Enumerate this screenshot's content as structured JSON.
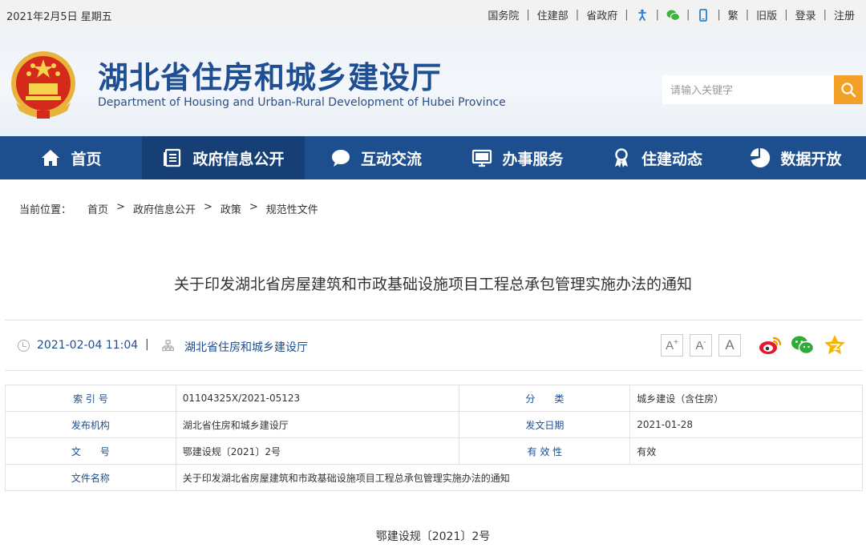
{
  "topbar": {
    "date": "2021年2月5日 星期五",
    "links": [
      "国务院",
      "住建部",
      "省政府",
      "繁",
      "旧版",
      "登录",
      "注册"
    ],
    "icons": [
      "accessibility-icon",
      "wechat-icon",
      "mobile-icon"
    ]
  },
  "header": {
    "title_cn": "湖北省住房和城乡建设厅",
    "title_en": "Department of Housing and Urban-Rural Development of Hubei Province",
    "search_placeholder": "请输入关键字"
  },
  "nav": {
    "items": [
      {
        "label": "首页",
        "icon": "home-icon"
      },
      {
        "label": "政府信息公开",
        "icon": "document-icon"
      },
      {
        "label": "互动交流",
        "icon": "chat-icon"
      },
      {
        "label": "办事服务",
        "icon": "monitor-icon"
      },
      {
        "label": "住建动态",
        "icon": "award-icon"
      },
      {
        "label": "数据开放",
        "icon": "pie-chart-icon"
      }
    ],
    "active_index": 1
  },
  "breadcrumb": {
    "prefix": "当前位置：",
    "items": [
      "首页",
      "政府信息公开",
      "政策",
      "规范性文件"
    ],
    "separator": ">"
  },
  "article": {
    "title": "关于印发湖北省房屋建筑和市政基础设施项目工程总承包管理实施办法的通知",
    "datetime": "2021-02-04 11:04",
    "divider": "|",
    "source": "湖北省住房和城乡建设厅",
    "font_buttons": [
      "A+",
      "A-",
      "A"
    ],
    "share_icons": [
      "weibo-icon",
      "wechat-icon",
      "favorite-star-icon"
    ],
    "doc_number_line": "鄂建设规〔2021〕2号"
  },
  "info_table": {
    "rows": [
      [
        {
          "k": "索 引 号",
          "v": "01104325X/2021-05123"
        },
        {
          "k": "分　　类",
          "v": "城乡建设（含住房）"
        }
      ],
      [
        {
          "k": "发布机构",
          "v": "湖北省住房和城乡建设厅"
        },
        {
          "k": "发文日期",
          "v": "2021-01-28"
        }
      ],
      [
        {
          "k": "文　　号",
          "v": "鄂建设规〔2021〕2号"
        },
        {
          "k": "有 效 性",
          "v": "有效"
        }
      ]
    ],
    "name_row": {
      "k": "文件名称",
      "v": "关于印发湖北省房屋建筑和市政基础设施项目工程总承包管理实施办法的通知"
    }
  },
  "colors": {
    "nav_bg": "#1d4f8f",
    "nav_active": "#163f76",
    "search_button": "#f4a026",
    "title_blue": "#1f4f93",
    "link_blue": "#1d4f8f"
  }
}
